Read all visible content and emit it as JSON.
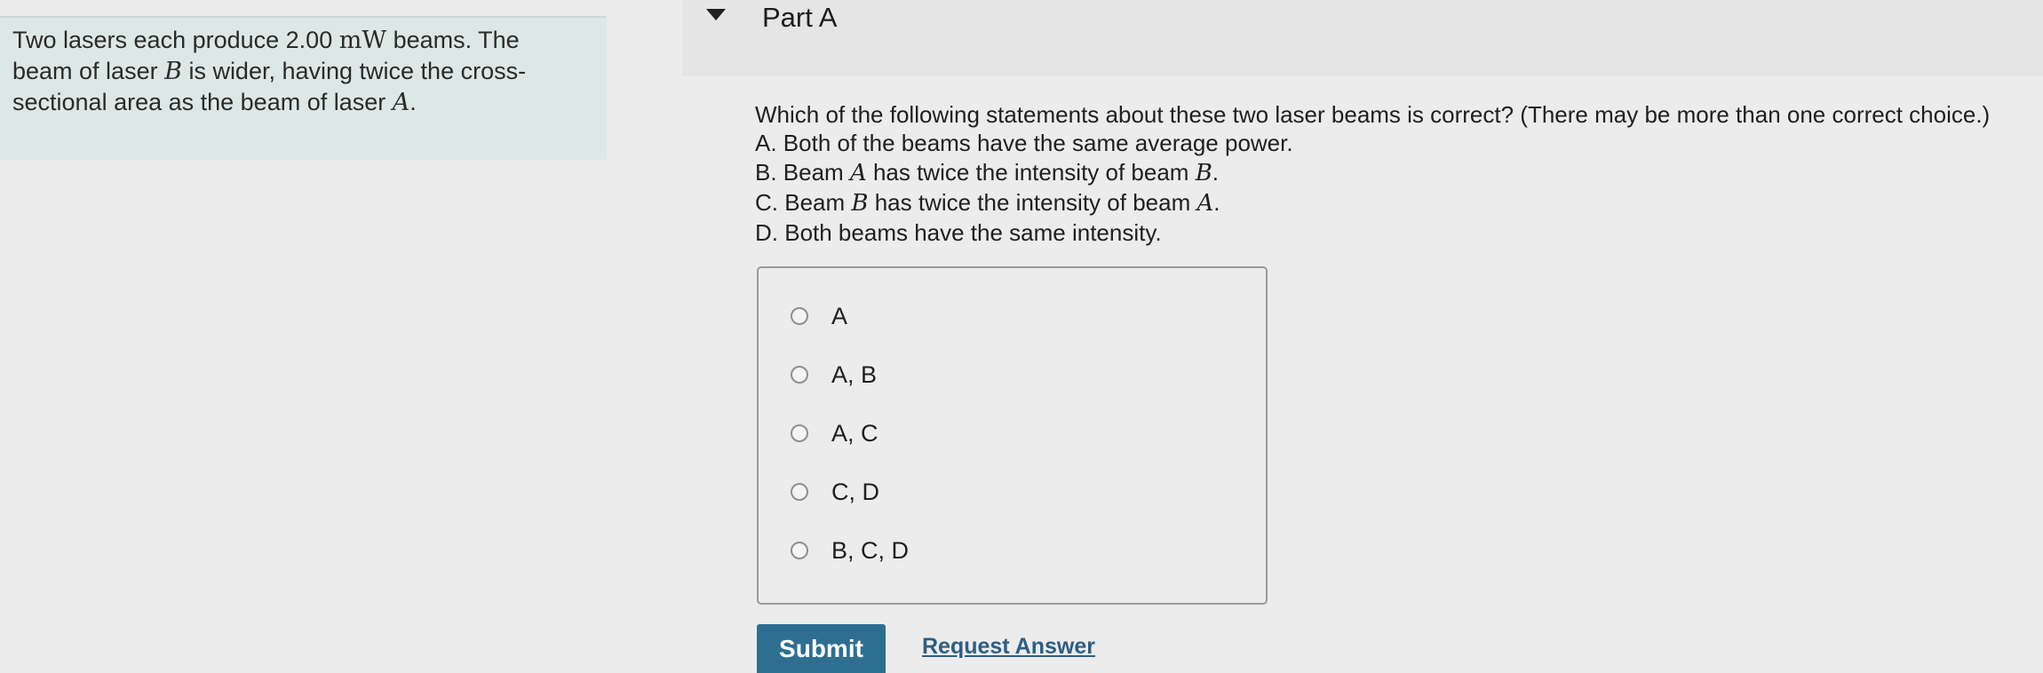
{
  "problem": {
    "segments": [
      {
        "text": "Two lasers each produce 2.00 ",
        "style": "plain"
      },
      {
        "text": "mW",
        "style": "math-upright"
      },
      {
        "text": " beams. The beam of laser ",
        "style": "plain"
      },
      {
        "text": "B",
        "style": "math"
      },
      {
        "text": " is wider, having twice the cross-sectional area as the beam of laser ",
        "style": "plain"
      },
      {
        "text": "A",
        "style": "math"
      },
      {
        "text": ".",
        "style": "plain"
      }
    ]
  },
  "part": {
    "title": "Part A"
  },
  "question": {
    "text": "Which of the following statements about these two laser beams is correct? (There may be more than one correct choice.)",
    "statements": [
      [
        {
          "text": "A. Both of the beams have the same average power.",
          "style": "plain"
        }
      ],
      [
        {
          "text": "B. Beam ",
          "style": "plain"
        },
        {
          "text": "A",
          "style": "math"
        },
        {
          "text": " has twice the intensity of beam ",
          "style": "plain"
        },
        {
          "text": "B",
          "style": "math"
        },
        {
          "text": ".",
          "style": "plain"
        }
      ],
      [
        {
          "text": "C. Beam ",
          "style": "plain"
        },
        {
          "text": "B",
          "style": "math"
        },
        {
          "text": " has twice the intensity of beam ",
          "style": "plain"
        },
        {
          "text": "A",
          "style": "math"
        },
        {
          "text": ".",
          "style": "plain"
        }
      ],
      [
        {
          "text": "D. Both beams have the same intensity.",
          "style": "plain"
        }
      ]
    ]
  },
  "options": [
    {
      "label": "A",
      "selected": false
    },
    {
      "label": "A, B",
      "selected": false
    },
    {
      "label": "A, C",
      "selected": false
    },
    {
      "label": "C, D",
      "selected": false
    },
    {
      "label": "B, C, D",
      "selected": false
    }
  ],
  "actions": {
    "submit_label": "Submit",
    "request_answer_label": "Request Answer"
  },
  "colors": {
    "panel_bg": "#dde8e6",
    "submit_bg": "#2e6f91",
    "link": "#2c5e85"
  }
}
